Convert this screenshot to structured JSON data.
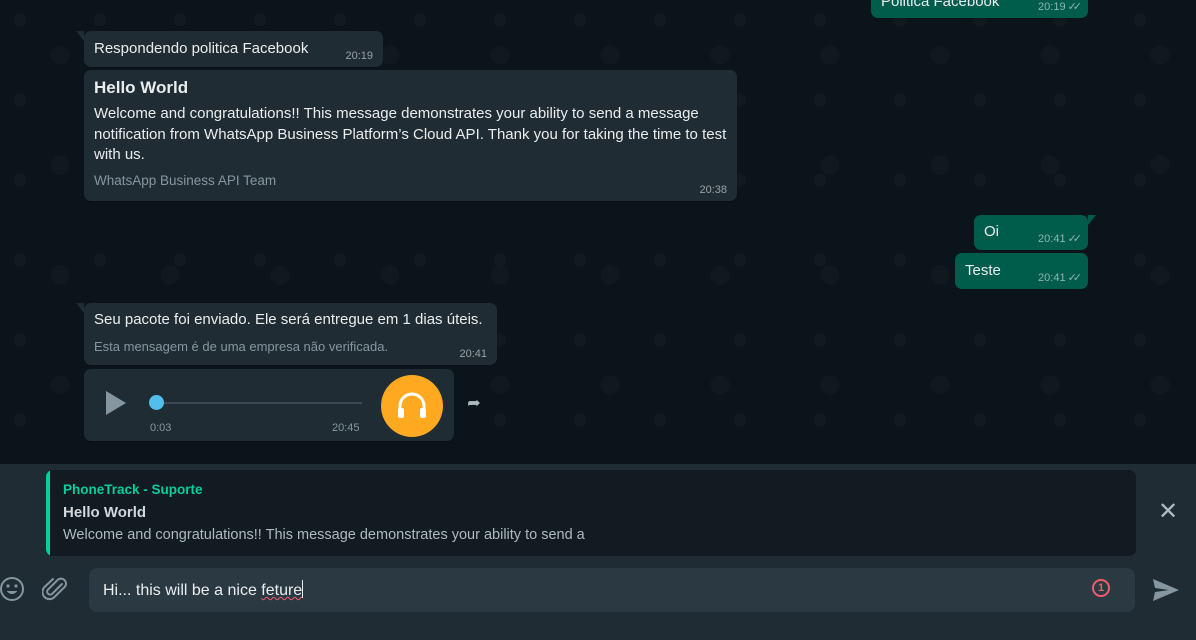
{
  "messages": {
    "top_out": {
      "text": "Politica Facebook",
      "time": "20:19"
    },
    "reply_in": {
      "text": "Respondendo politica Facebook",
      "time": "20:19"
    },
    "template_in": {
      "title": "Hello World",
      "body": "Welcome and congratulations!! This message demonstrates your ability to send a message notification from WhatsApp Business Platform’s Cloud API. Thank you for taking the time to test with us.",
      "footer": "WhatsApp Business API Team",
      "time": "20:38"
    },
    "oi_out": {
      "text": "Oi",
      "time": "20:41"
    },
    "teste_out": {
      "text": "Teste",
      "time": "20:41"
    },
    "package_in": {
      "text": "Seu pacote foi enviado. Ele será entregue em 1 dias úteis.",
      "note": "Esta mensagem é de uma empresa não verificada.",
      "time": "20:41"
    },
    "audio_in": {
      "position": "0:03",
      "time": "20:45",
      "progress": 0.0
    }
  },
  "reply_preview": {
    "sender": "PhoneTrack - Suporte",
    "title": "Hello World",
    "snippet": "Welcome and congratulations!! This message demonstrates your ability to send a"
  },
  "composer": {
    "text_before": "Hi... this will be a nice ",
    "misspelled_word": "feture",
    "error_count": "1"
  },
  "colors": {
    "incoming": "#202c33",
    "outgoing": "#005c4b",
    "accent": "#06cf9c",
    "audio_avatar": "#ffa920",
    "error": "#f15c6d"
  }
}
